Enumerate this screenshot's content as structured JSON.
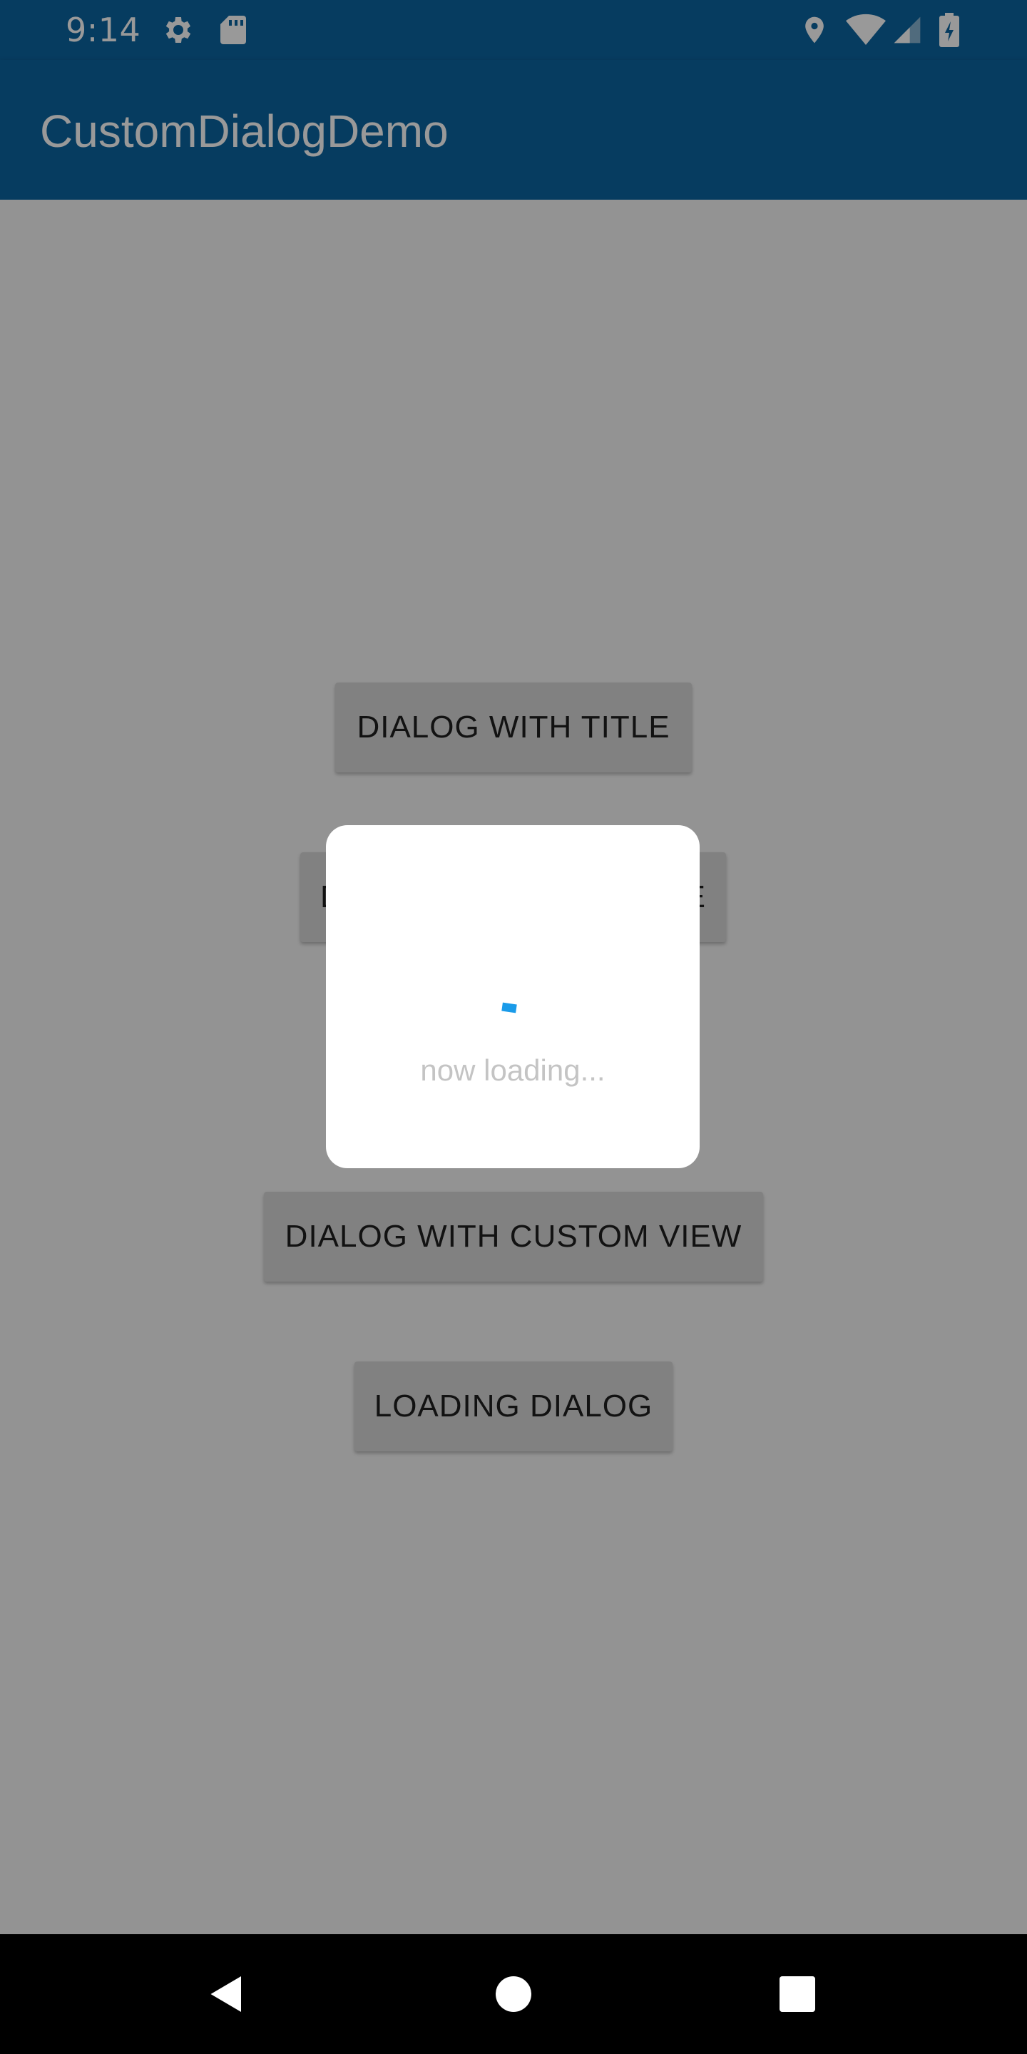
{
  "status_bar": {
    "time": "9:14",
    "icons_left": [
      "settings-gear-icon",
      "sd-card-icon"
    ],
    "icons_right": [
      "location-icon",
      "wifi-icon",
      "cell-signal-icon",
      "battery-charging-icon"
    ]
  },
  "app_bar": {
    "title": "CustomDialogDemo"
  },
  "buttons": {
    "dialog_with_title": "DIALOG WITH TITLE",
    "dialog_hidden_label_start": "D",
    "dialog_hidden_label_end": "E",
    "dialog_with_custom_view": "DIALOG WITH CUSTOM VIEW",
    "loading_dialog": "LOADING DIALOG"
  },
  "dialog": {
    "message": "now loading..."
  },
  "nav_bar": {
    "items": [
      "back-icon",
      "home-icon",
      "recents-icon"
    ]
  },
  "colors": {
    "app_bar": "#0b64a0",
    "spinner": "#1a9be9",
    "button": "#d7d7d7",
    "background": "#f5f5f5"
  }
}
